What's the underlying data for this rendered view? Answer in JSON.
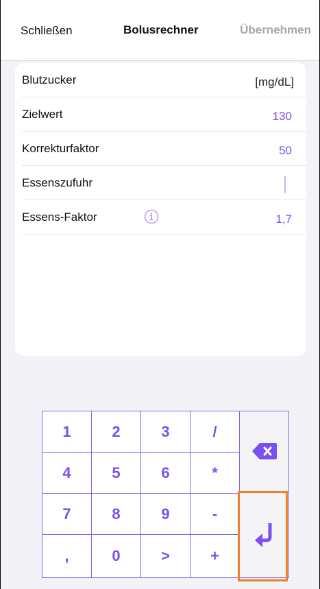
{
  "nav": {
    "close_label": "Schließen",
    "title": "Bolusrechner",
    "apply_label": "Übernehmen"
  },
  "rows": [
    {
      "label": "Blutzucker",
      "value": "[mg/dL]"
    },
    {
      "label": "Zielwert",
      "value": "130"
    },
    {
      "label": "Korrekturfaktor",
      "value": "50"
    },
    {
      "label": "Essenszufuhr",
      "value": ""
    },
    {
      "label": "Essens-Faktor",
      "value": "1,7"
    }
  ],
  "keys": {
    "k1": "1",
    "k2": "2",
    "k3": "3",
    "kdiv": "/",
    "k4": "4",
    "k5": "5",
    "k6": "6",
    "kmul": "*",
    "k7": "7",
    "k8": "8",
    "k9": "9",
    "kminus": "-",
    "kcomma": ",",
    "k0": "0",
    "kgt": ">",
    "kplus": "+"
  },
  "icons": {
    "info": "info-icon",
    "backspace": "backspace-icon",
    "enter": "return-arrow-icon"
  },
  "colors": {
    "accent": "#7b4ff0",
    "highlight": "#ef7f2a"
  }
}
